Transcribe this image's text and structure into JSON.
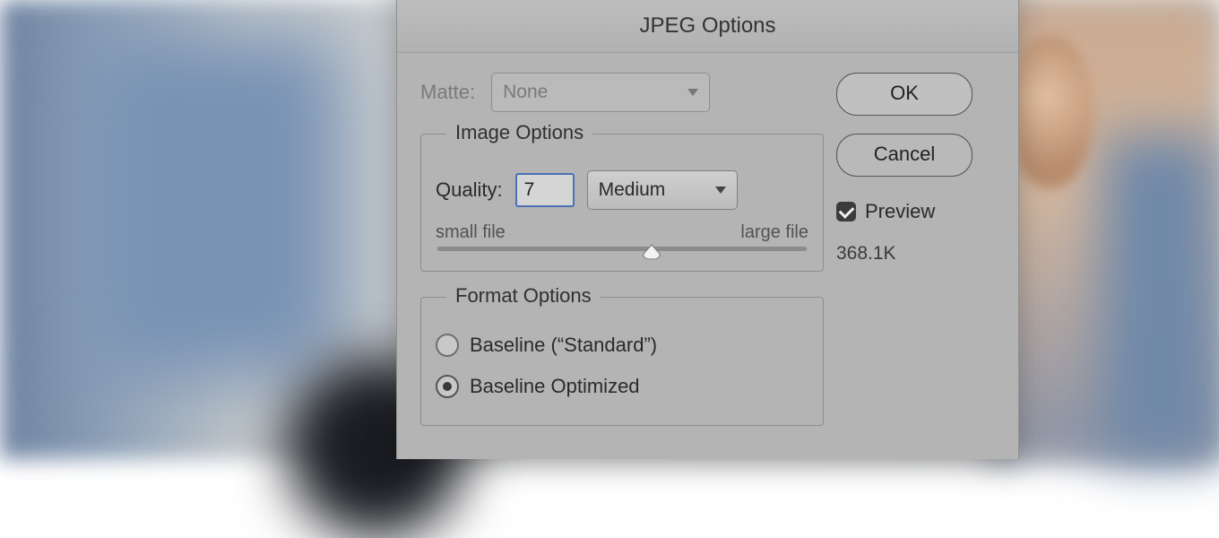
{
  "dialog": {
    "title": "JPEG Options"
  },
  "matte": {
    "label": "Matte:",
    "value": "None"
  },
  "image_options": {
    "legend": "Image Options",
    "quality_label": "Quality:",
    "quality_value": "7",
    "preset": "Medium",
    "slider": {
      "min_label": "small file",
      "max_label": "large file",
      "value": 7,
      "min": 0,
      "max": 12
    }
  },
  "format_options": {
    "legend": "Format Options",
    "options": [
      {
        "label": "Baseline (“Standard”)",
        "checked": false
      },
      {
        "label": "Baseline Optimized",
        "checked": true
      }
    ]
  },
  "buttons": {
    "ok": "OK",
    "cancel": "Cancel"
  },
  "preview": {
    "label": "Preview",
    "checked": true
  },
  "filesize": "368.1K"
}
